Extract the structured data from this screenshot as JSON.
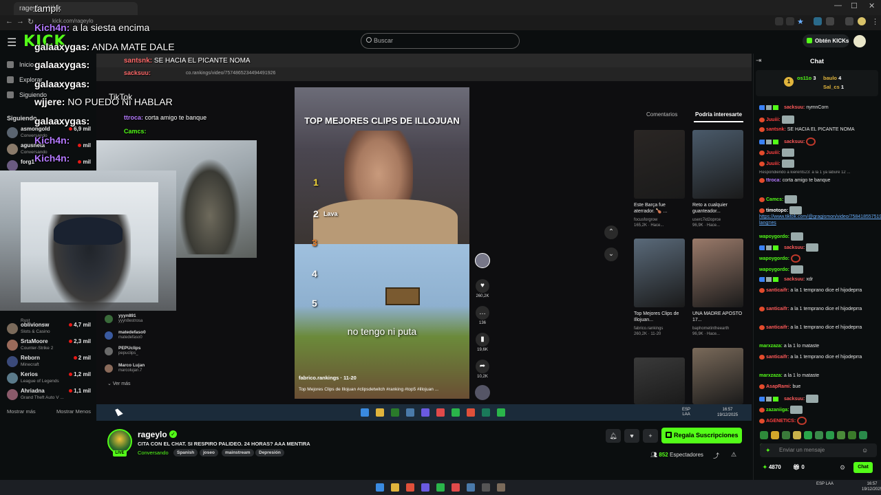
{
  "browser": {
    "tab_title": "rageylo - Kick",
    "url": "kick.com/rageylo",
    "window_min": "—",
    "window_max": "☐",
    "window_close": "✕"
  },
  "header": {
    "logo": "KICK",
    "search_placeholder": "Buscar",
    "kicks_button": "Obtén KICKs"
  },
  "sidebar": {
    "nav": [
      {
        "label": "Inicio"
      },
      {
        "label": "Explorar"
      },
      {
        "label": "Siguiendo"
      }
    ],
    "following_title": "Siguiendo",
    "channels_top": [
      {
        "name": "asmongold",
        "category": "Conversando",
        "viewers": "6,9 mil",
        "color": "#5a6470"
      },
      {
        "name": "agusneta",
        "category": "Conversando",
        "viewers": "mil",
        "color": "#8a7a6a"
      },
      {
        "name": "forg1",
        "category": "",
        "viewers": "mil",
        "color": "#6a5a80"
      }
    ],
    "channels_bottom": [
      {
        "name": "",
        "category": "Rust",
        "viewers": "",
        "color": "#444"
      },
      {
        "name": "oblivionsw",
        "category": "Slots & Casino",
        "viewers": "4,7 mil",
        "color": "#7a6a5a"
      },
      {
        "name": "SrtaMoore",
        "category": "Counter-Strike 2",
        "viewers": "2,3 mil",
        "color": "#9a6a5a"
      },
      {
        "name": "Reborn",
        "category": "Minecraft",
        "viewers": "2 mil",
        "color": "#3a4a7a"
      },
      {
        "name": "Kerios",
        "category": "League of Legends",
        "viewers": "1,2 mil",
        "color": "#5a7a8a"
      },
      {
        "name": "Ahriadna",
        "category": "Grand Theft Auto V ...",
        "viewers": "1,1 mil",
        "color": "#8a5a6a"
      }
    ],
    "show_more": "Mostrar más",
    "show_less": "Mostrar Menos"
  },
  "overlay_chat": [
    {
      "user": "",
      "text": "tampl:"
    },
    {
      "user": "Kich4n:",
      "text": "a la siesta encima"
    },
    {
      "user": "galaaxygas:",
      "text": "ANDA MATE DALE"
    },
    {
      "user": "galaaxygas:",
      "text": ""
    },
    {
      "user": "galaaxygas:",
      "text": ""
    },
    {
      "user": "wjjere:",
      "text": "NO PUEDO NI HABLAR"
    },
    {
      "user": "galaaxygas:",
      "text": ""
    },
    {
      "user": "Kich4n:",
      "text": ""
    },
    {
      "user": "Kich4n:",
      "text": ""
    }
  ],
  "inner_overlay": [
    {
      "user": "santsnk:",
      "text": "SE HACIA EL PICANTE NOMA"
    },
    {
      "user": "sacksuu:",
      "text": ""
    },
    {
      "user": "",
      "text": "TikTok"
    },
    {
      "user": "ttroca:",
      "text": "corta amigo te banque"
    },
    {
      "user": "Camcs:",
      "text": ""
    }
  ],
  "inner_browser": {
    "url": "co.rankings/video/7574865234494491926"
  },
  "video": {
    "title": "TOP MEJORES CLIPS DE ILLOJUAN",
    "ranks": [
      "1",
      "2",
      "3",
      "4",
      "5"
    ],
    "rank2_label": "Lava",
    "caption": "no tengo ni puta",
    "author": "fabrico.rankings · 11-20",
    "description": "Top Mejores Clips de Illojuan #clipsdetwitch #ranking #top5 #illojuan ...",
    "likes": "260,2K",
    "comments": "136",
    "saves": "19,6K",
    "shares": "10,2K"
  },
  "tiktok_panel": {
    "tab_comments": "Comentarios",
    "tab_interest": "Podría interesarte",
    "items": [
      {
        "title": "Este Barça fue aterrador. 🍗 ...",
        "author": "focusforgrow",
        "meta": "165,2K · Hace...",
        "color": "#2a2624"
      },
      {
        "title": "Reto a cualquier guanteador...",
        "author": "userc7id2oprce",
        "meta": "96,9K · Hace...",
        "color": "#4a5a6a"
      },
      {
        "title": "Top Mejores Clips de Illojuan...",
        "author": "fabrico.rankings",
        "meta": "260,2K · 11-20",
        "color": "#5a6a7a"
      },
      {
        "title": "UNA MADRE APOSTO 17...",
        "author": "baphometintheearth",
        "meta": "96,9K · Hace...",
        "color": "#9a7a6a"
      },
      {
        "title": "",
        "author": "",
        "meta": "",
        "color": "#3a3a3a"
      },
      {
        "title": "",
        "author": "",
        "meta": "",
        "color": "#7a6a5a"
      }
    ]
  },
  "inner_followers": [
    {
      "name": "yyyn891",
      "sub": "yyyn8estrosa"
    },
    {
      "name": "matedefaso0",
      "sub": "matedefaso0"
    },
    {
      "name": "PEPUclips",
      "sub": "pepuclips_"
    },
    {
      "name": "Marco Lujan",
      "sub": "marcolujan.7"
    }
  ],
  "inner_see_more": "Ver más",
  "inner_clock": {
    "time": "16:57",
    "date": "19/12/2025",
    "lang": "ESP LAA"
  },
  "channel": {
    "name": "rageylo",
    "title": "CITA CON EL CHAT. SI RESPIRO PALIDEO. 24 HORAS? AAA MENTIRA",
    "category": "Conversando",
    "tags": [
      "Spanish",
      "joseo",
      "mainstream",
      "Depresión"
    ],
    "live": "LIVE",
    "subs_button": "Regala Suscripciones",
    "viewers": "852",
    "viewers_label": "Espectadores"
  },
  "chat": {
    "title": "Chat",
    "pinned": [
      {
        "user": "os11o",
        "count": "3",
        "color": "#53fc18"
      },
      {
        "user": "baulo",
        "count": "4",
        "color": "#e0b43c"
      },
      {
        "user": "Sal_cs",
        "count": "1",
        "color": "#e0b43c"
      }
    ],
    "reply_ref": "Respondiendo a kierents23: a la 1 ya labure 12 ...",
    "messages": [
      {
        "user": "sacksuu:",
        "text": "nymnCorn",
        "color": "#ff5a5a",
        "badge": "full"
      },
      {
        "user": "Juuiii:",
        "text": "",
        "color": "#ff4040",
        "badge": "one"
      },
      {
        "user": "santsnk:",
        "text": "SE HACIA EL PICANTE NOMA",
        "color": "#ff4040",
        "badge": "one"
      },
      {
        "user": "sacksuu:",
        "text": "",
        "color": "#ff5a5a",
        "badge": "full"
      },
      {
        "user": "Juuiii:",
        "text": "",
        "color": "#ff4040",
        "badge": "one"
      },
      {
        "user": "Juuiii:",
        "text": "",
        "color": "#ff4040",
        "badge": "one"
      },
      {
        "user": "ttroca:",
        "text": "corta amigo te banque",
        "color": "#b57aff",
        "badge": "one"
      },
      {
        "user": "Camcs:",
        "text": "",
        "color": "#53fc18",
        "badge": "one"
      },
      {
        "user": "timotopo:",
        "text": "",
        "color": "#fff",
        "badge": "one"
      },
      {
        "user": "",
        "text": "https://www.tiktok.com/@gragismon/video/7584185575192710408?lang=es",
        "color": "#fff",
        "badge": "none"
      },
      {
        "user": "wapoygordo:",
        "text": "",
        "color": "#53fc18",
        "badge": "none"
      },
      {
        "user": "sacksuu:",
        "text": "",
        "color": "#ff5a5a",
        "badge": "full"
      },
      {
        "user": "wapoygordo:",
        "text": "",
        "color": "#53fc18",
        "badge": "none"
      },
      {
        "user": "wapoygordo:",
        "text": "",
        "color": "#53fc18",
        "badge": "none"
      },
      {
        "user": "sacksuu:",
        "text": "xdr",
        "color": "#ff5a5a",
        "badge": "full"
      },
      {
        "user": "santicaifr:",
        "text": "a la 1 temprano dice el hijodeprra",
        "color": "#ff5a5a",
        "badge": "one"
      },
      {
        "user": "santicaifr:",
        "text": "a la 1 temprano dice el hijodeprra",
        "color": "#ff5a5a",
        "badge": "one"
      },
      {
        "user": "santicaifr:",
        "text": "a la 1 temprano dice el hijodeprra",
        "color": "#ff5a5a",
        "badge": "one"
      },
      {
        "user": "marxzaza:",
        "text": "a la 1 lo mataste",
        "color": "#53fc18",
        "badge": "none"
      },
      {
        "user": "santicaifr:",
        "text": "a la 1 temprano dice el hijodeprra",
        "color": "#ff5a5a",
        "badge": "one"
      },
      {
        "user": "marxzaza:",
        "text": "a la 1 lo mataste",
        "color": "#53fc18",
        "badge": "none"
      },
      {
        "user": "AsapRami:",
        "text": "bue",
        "color": "#ff5a5a",
        "badge": "one"
      },
      {
        "user": "sacksuu:",
        "text": "",
        "color": "#ff5a5a",
        "badge": "full"
      },
      {
        "user": "zazaniiga:",
        "text": "",
        "color": "#53fc18",
        "badge": "one"
      },
      {
        "user": "AGENETICS:",
        "text": "",
        "color": "#ff4040",
        "badge": "one"
      }
    ],
    "input_placeholder": "Enviar un mensaje",
    "points": "4870",
    "gifts": "0",
    "send_button": "Chat"
  },
  "os": {
    "time": "16:57",
    "date": "19/12/2025",
    "lang": "ESP LAA"
  },
  "colors": {
    "accent": "#53fc18",
    "live": "#e91916",
    "bg": "#0b0e0f"
  }
}
